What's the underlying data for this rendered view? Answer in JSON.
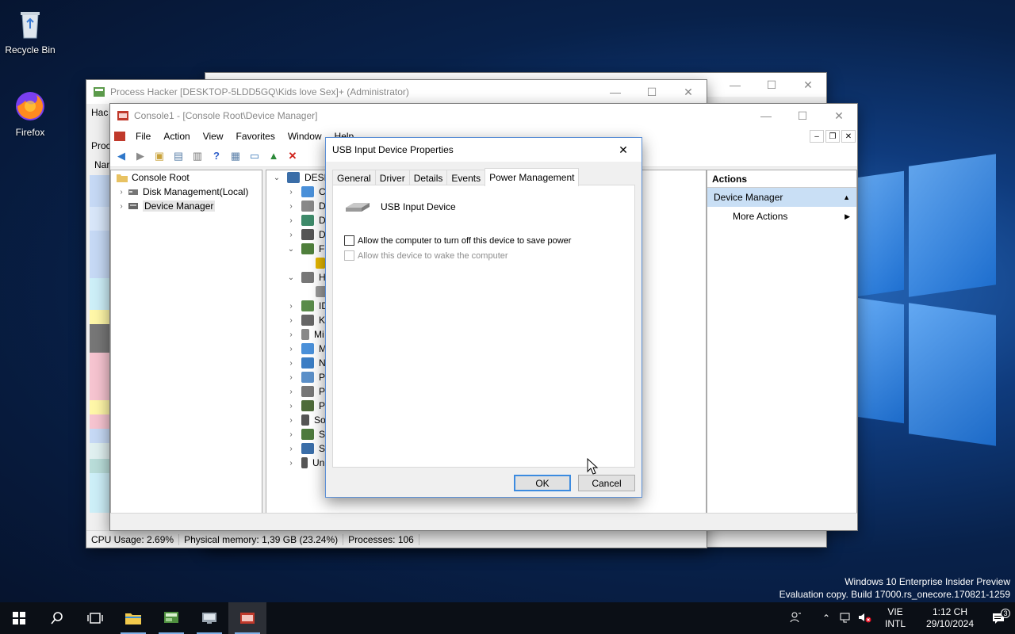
{
  "desktop": {
    "icons": [
      {
        "label": "Recycle Bin",
        "icon": "recycle-bin-icon"
      },
      {
        "label": "Firefox",
        "icon": "firefox-icon"
      }
    ]
  },
  "process_hacker": {
    "title": "Process Hacker [DESKTOP-5LDD5GQ\\Kids love Sex]+ (Administrator)",
    "partial_menu": "Hac",
    "partial_tab": "Proc",
    "partial_col": "Nar",
    "status": {
      "cpu": "CPU Usage: 2.69%",
      "memory": "Physical memory: 1,39 GB (23.24%)",
      "processes": "Processes: 106"
    }
  },
  "console": {
    "title": "Console1 - [Console Root\\Device Manager]",
    "menu": [
      "File",
      "Action",
      "View",
      "Favorites",
      "Window",
      "Help"
    ],
    "tree": {
      "root": "Console Root",
      "children": [
        "Disk Management(Local)",
        "Device Manager"
      ]
    },
    "devices": {
      "root": "DESKT",
      "rows": [
        {
          "label": "Co",
          "expand": "›"
        },
        {
          "label": "Dis",
          "expand": "›"
        },
        {
          "label": "Dis",
          "expand": "›"
        },
        {
          "label": "DV",
          "expand": "›"
        },
        {
          "label": "Flo",
          "expand": "⌄"
        },
        {
          "label": "",
          "expand": ""
        },
        {
          "label": "Hu",
          "expand": "⌄"
        },
        {
          "label": "",
          "expand": ""
        },
        {
          "label": "IDI",
          "expand": "›"
        },
        {
          "label": "Ke",
          "expand": "›"
        },
        {
          "label": "Mi",
          "expand": "›"
        },
        {
          "label": "Mo",
          "expand": "›"
        },
        {
          "label": "Ne",
          "expand": "›"
        },
        {
          "label": "Po",
          "expand": "›"
        },
        {
          "label": "Pri",
          "expand": "›"
        },
        {
          "label": "Pro",
          "expand": "›"
        },
        {
          "label": "So",
          "expand": "›"
        },
        {
          "label": "Sto",
          "expand": "›"
        },
        {
          "label": "Sys",
          "expand": "›"
        },
        {
          "label": "Un",
          "expand": "›"
        }
      ]
    },
    "actions": {
      "header": "Actions",
      "section": "Device Manager",
      "more": "More Actions"
    }
  },
  "dialog": {
    "title": "USB Input Device Properties",
    "tabs": [
      "General",
      "Driver",
      "Details",
      "Events",
      "Power Management"
    ],
    "active_tab": "Power Management",
    "device_name": "USB Input Device",
    "options": [
      {
        "label": "Allow the computer to turn off this device to save power",
        "checked": false,
        "enabled": true
      },
      {
        "label": "Allow this device to wake the computer",
        "checked": false,
        "enabled": false
      }
    ],
    "ok_label": "OK",
    "cancel_label": "Cancel"
  },
  "watermark": {
    "line1": "Windows 10 Enterprise Insider Preview",
    "line2": "Evaluation copy. Build 17000.rs_onecore.170821-1259"
  },
  "taskbar": {
    "language_top": "VIE",
    "language_bottom": "INTL",
    "time": "1:12 CH",
    "date": "29/10/2024",
    "notification_count": "3"
  },
  "colors": {
    "accent": "#3c8be0",
    "selection": "#c9dff5",
    "taskbar": "#0b0f16"
  }
}
